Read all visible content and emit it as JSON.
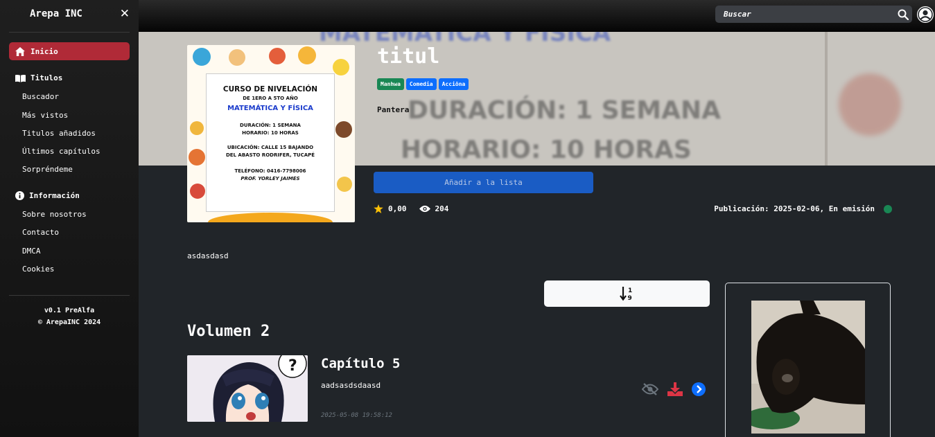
{
  "sidebar": {
    "brand": "Arepa INC",
    "home_label": "Inicio",
    "titles_section": "Titulos",
    "titles_items": [
      "Buscador",
      "Más vistos",
      "Titulos añadidos",
      "Últimos capítulos",
      "Sorpréndeme"
    ],
    "info_section": "Información",
    "info_items": [
      "Sobre nosotros",
      "Contacto",
      "DMCA",
      "Cookies"
    ],
    "version": "v0.1 PreAlfa",
    "copyright": "© ArepaINC 2024"
  },
  "topbar": {
    "search_placeholder": "Buscar"
  },
  "cover": {
    "line1": "CURSO DE NIVELACIÓN",
    "line2": "DE 1ERO A 5TO AÑO",
    "line3": "MATEMÁTICA Y FÍSICA",
    "line4a": "DURACIÓN: 1 SEMANA",
    "line4b": "HORARIO: 10 HORAS",
    "line5a": "UBICACIÓN: CALLE 15 BAJANDO",
    "line5b": "DEL ABASTO RODRIFER, TUCAPÉ",
    "line6a": "TELÉFONO: 0416-7798006",
    "line6b": "PROF. YORLEY JAIMES"
  },
  "hero_bg": {
    "line1": "MATEMÁTICA Y FÍSICA",
    "line2": "DURACIÓN: 1 SEMANA",
    "line3": "HORARIO: 10 HORAS"
  },
  "title": {
    "name": "titul",
    "tags": [
      {
        "label": "Manhwa",
        "color": "#198754"
      },
      {
        "label": "Comedia",
        "color": "#0d6efd"
      },
      {
        "label": "Acciōna",
        "color": "#0d6efd"
      }
    ],
    "author": "Pantera",
    "add_button": "Añadir a la lista",
    "rating": "0,00",
    "views": "204",
    "publication": "Publicación: 2025-02-06, En emisión",
    "status_color": "#198754",
    "description": "asdasdasd"
  },
  "volume": {
    "title": "Volumen 2",
    "chapters": [
      {
        "title": "Capítulo 5",
        "subtitle": "aadsasdsdaasd",
        "date": "2025-05-08 19:58:12"
      }
    ]
  },
  "icons": {
    "home": "home-icon",
    "book": "book-icon",
    "info": "info-icon",
    "search": "search-icon",
    "user": "user-icon",
    "sort": "sort-icon",
    "star": "star-icon",
    "eye": "eye-icon",
    "eye_slash": "eye-slash-icon",
    "download": "download-icon",
    "arrow": "arrow-right-circle-icon"
  }
}
